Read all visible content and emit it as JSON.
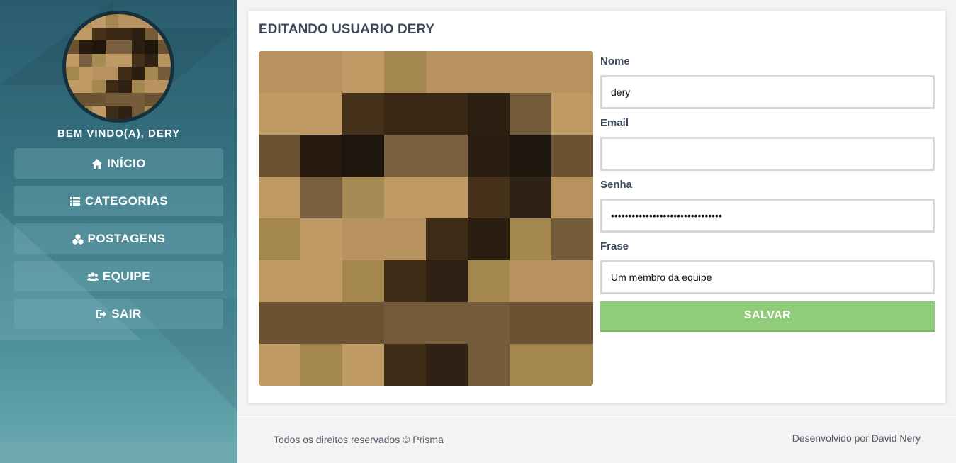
{
  "sidebar": {
    "welcome": "BEM VINDO(A), DERY",
    "items": [
      {
        "icon": "home-icon",
        "label": "INÍCIO"
      },
      {
        "icon": "list-icon",
        "label": "CATEGORIAS"
      },
      {
        "icon": "cubes-icon",
        "label": "POSTAGENS"
      },
      {
        "icon": "users-icon",
        "label": "EQUIPE"
      },
      {
        "icon": "sign-out-icon",
        "label": "SAIR"
      }
    ]
  },
  "main": {
    "title": "EDITANDO USUARIO DERY",
    "form": {
      "name_label": "Nome",
      "name_value": "dery",
      "email_label": "Email",
      "email_value": "",
      "password_label": "Senha",
      "password_value": "••••••••••••••••••••••••••••••••",
      "phrase_label": "Frase",
      "phrase_value": "Um membro da equipe",
      "save_label": "SALVAR"
    }
  },
  "footer": {
    "copyright": "Todos os direitos reservados © Prisma",
    "credit": "Desenvolvido por David Nery"
  },
  "colors": {
    "save_button": "#90cc79",
    "title_text": "#3d4a5c",
    "sidebar_dark": "#2a5c6e"
  }
}
